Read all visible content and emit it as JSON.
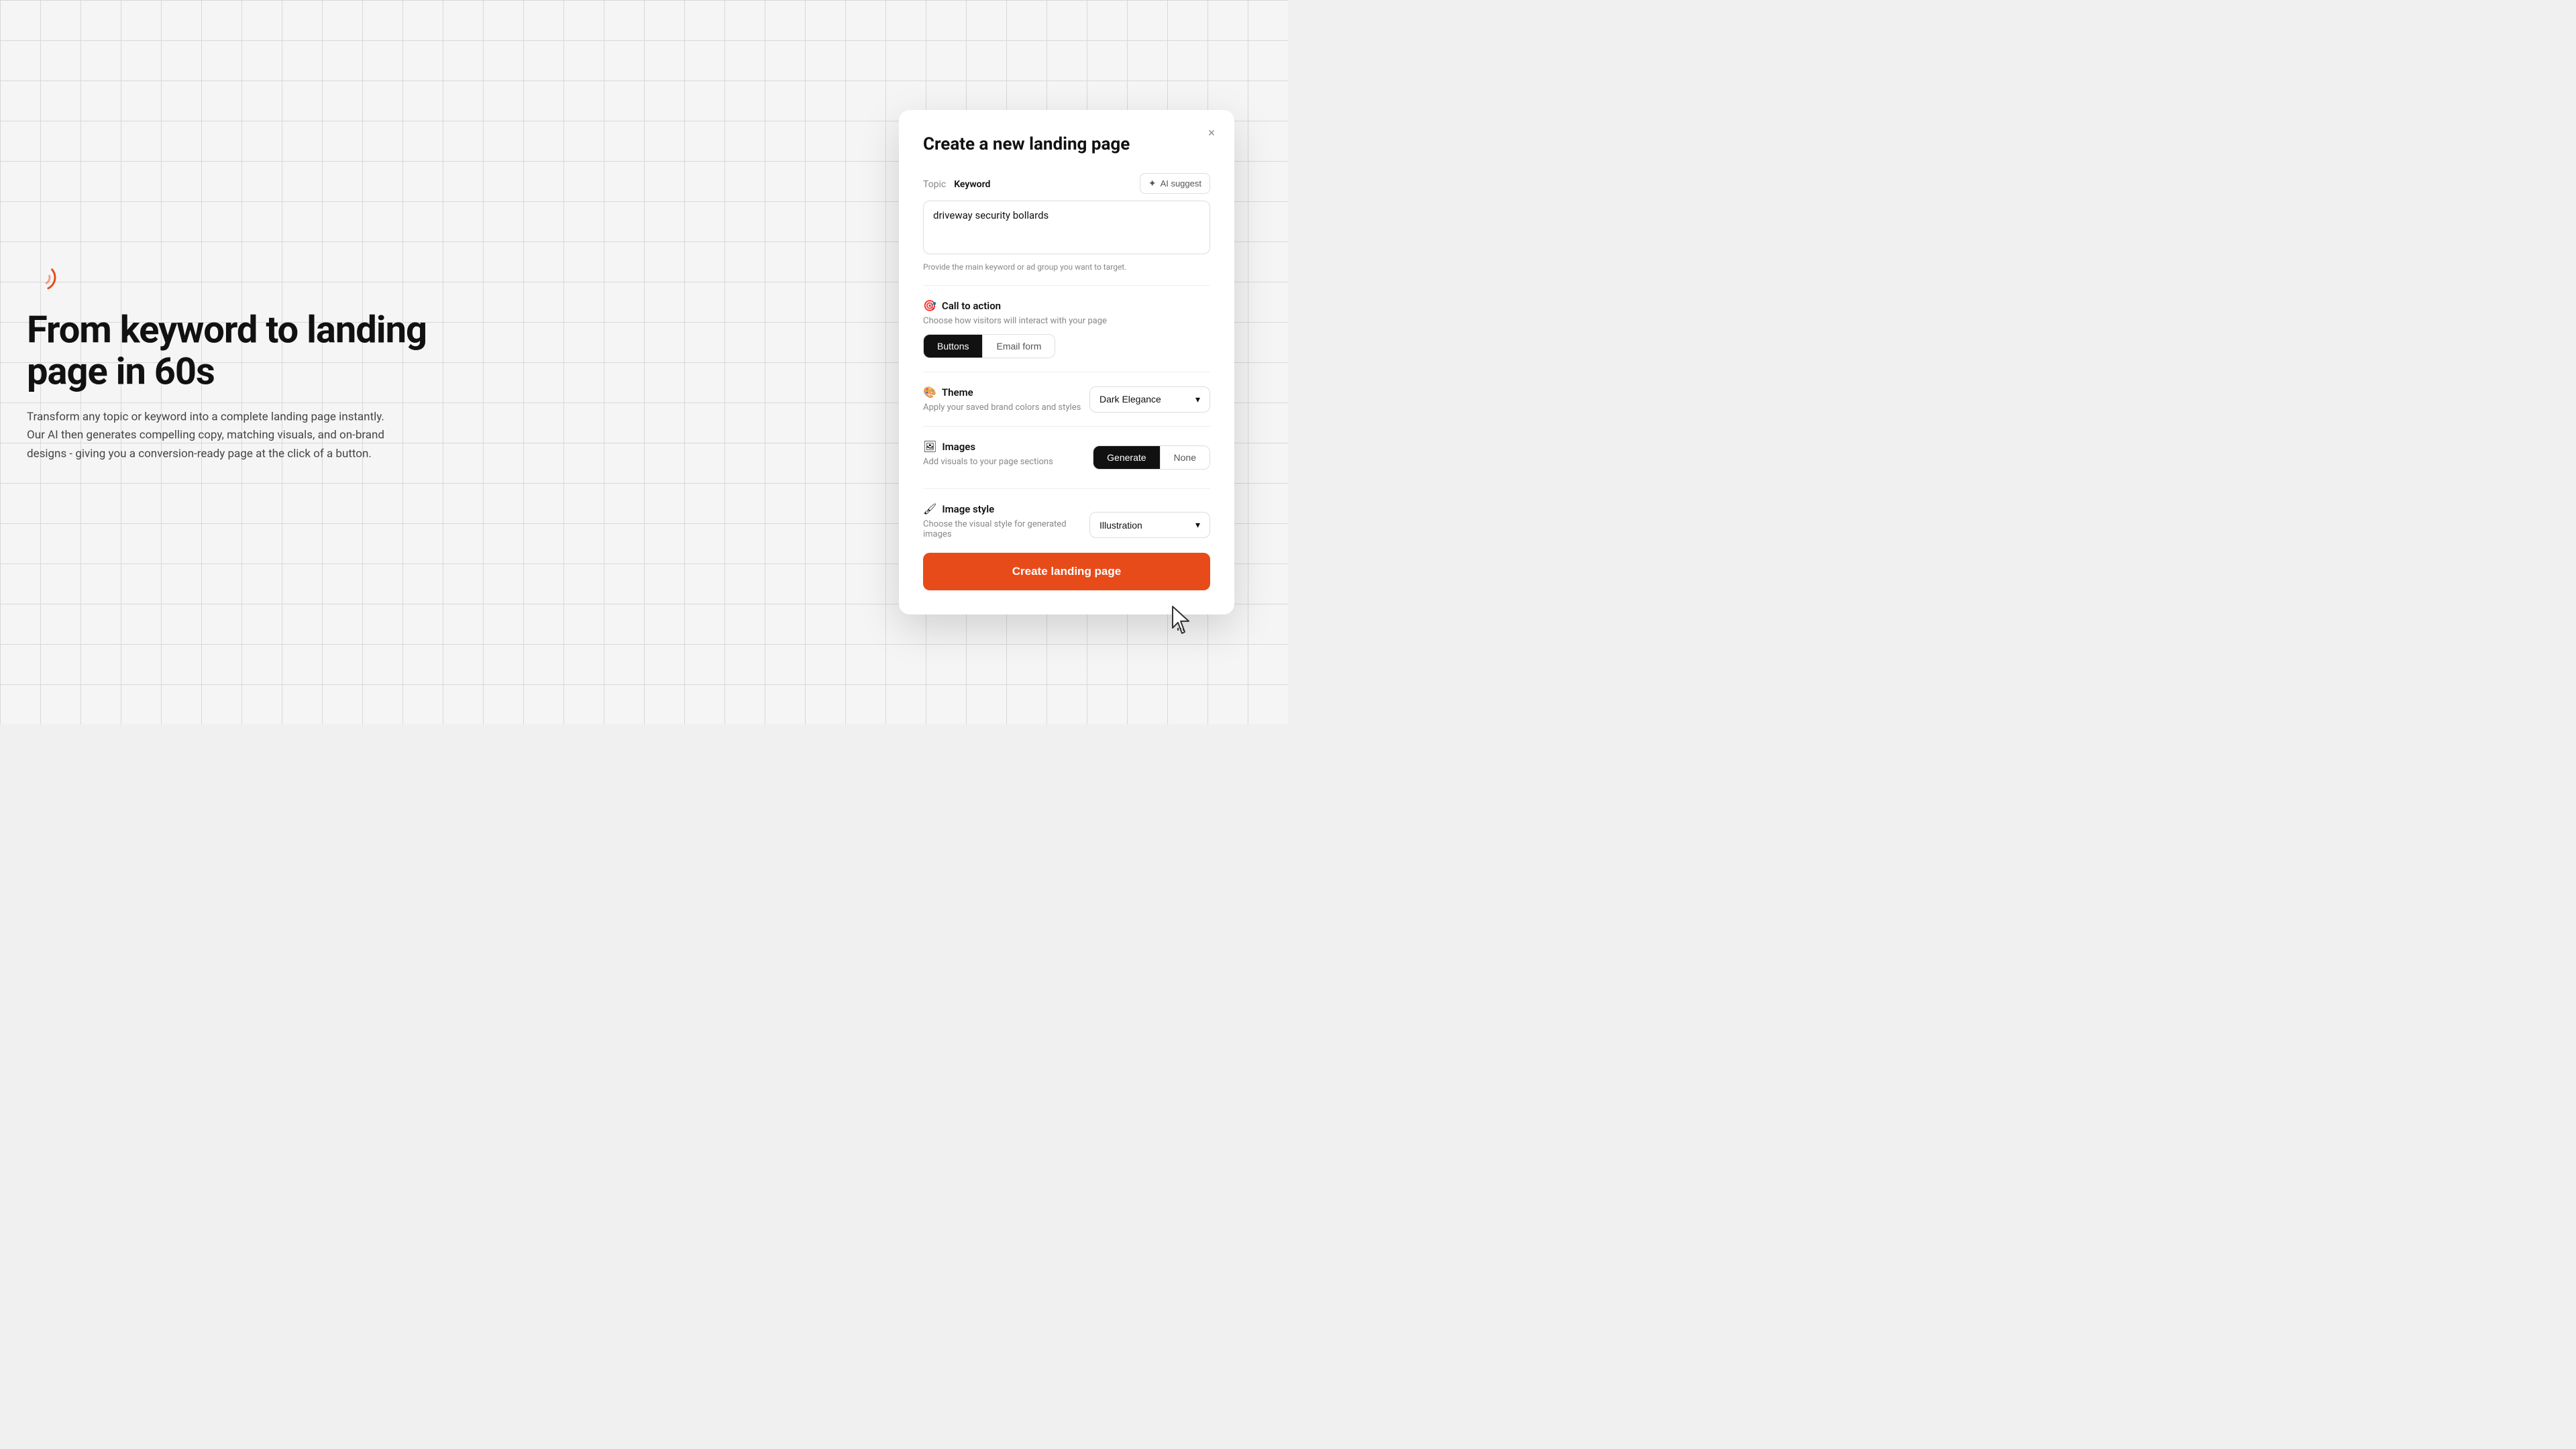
{
  "background": {
    "color": "#f5f5f5"
  },
  "hero": {
    "title": "From keyword to landing page in 60s",
    "subtitle": "Transform any topic or keyword into a complete landing page instantly. Our AI then generates compelling copy, matching visuals, and on-brand designs - giving you a conversion-ready page at the click of a button.",
    "spinner_icon": "spinner-icon"
  },
  "modal": {
    "title": "Create a new landing page",
    "close_label": "×",
    "topic": {
      "label": "Topic",
      "value": "Keyword",
      "textarea_value": "driveway security bollards",
      "hint": "Provide the main keyword or ad group you want to target.",
      "ai_suggest_label": "AI suggest"
    },
    "call_to_action": {
      "section_label": "Call to action",
      "description": "Choose how visitors will interact with your page",
      "options": [
        {
          "label": "Buttons",
          "active": true
        },
        {
          "label": "Email form",
          "active": false
        }
      ]
    },
    "theme": {
      "section_label": "Theme",
      "description": "Apply your saved brand colors and styles",
      "selected_value": "Dark Elegance",
      "chevron": "▾"
    },
    "images": {
      "section_label": "Images",
      "description": "Add visuals to your page sections",
      "options": [
        {
          "label": "Generate",
          "active": true
        },
        {
          "label": "None",
          "active": false
        }
      ]
    },
    "image_style": {
      "section_label": "Image style",
      "description": "Choose the visual style for generated images",
      "selected_value": "Illustration",
      "chevron": "▾"
    },
    "create_button_label": "Create landing page"
  }
}
